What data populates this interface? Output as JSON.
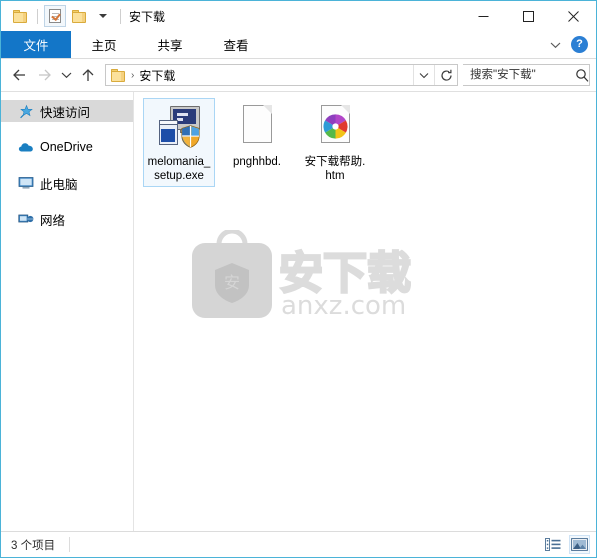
{
  "window": {
    "title": "安下载",
    "quick_access": {
      "folder_icon": "folder-icon",
      "properties_icon": "document-check-icon",
      "new_folder_icon": "folder-icon",
      "customize_icon": "chevron-down-icon"
    },
    "controls": {
      "minimize": "minimize-icon",
      "maximize": "maximize-icon",
      "close": "close-icon"
    }
  },
  "ribbon": {
    "tabs": [
      {
        "label": "文件",
        "active": true
      },
      {
        "label": "主页",
        "active": false
      },
      {
        "label": "共享",
        "active": false
      },
      {
        "label": "查看",
        "active": false
      }
    ],
    "collapse_icon": "chevron-down-icon",
    "help_label": "?"
  },
  "addressbar": {
    "back_icon": "arrow-left-icon",
    "forward_icon": "arrow-right-icon",
    "recent_icon": "chevron-down-icon",
    "up_icon": "arrow-up-icon",
    "folder_icon": "folder-icon",
    "breadcrumb": "安下载",
    "breadcrumb_separator": "›",
    "dropdown_icon": "chevron-down-icon",
    "refresh_icon": "refresh-icon"
  },
  "search": {
    "placeholder": "搜索\"安下载\"",
    "value": "",
    "icon": "search-icon"
  },
  "sidebar": {
    "items": [
      {
        "label": "快速访问",
        "icon": "star-pin-icon",
        "selected": true
      },
      {
        "label": "OneDrive",
        "icon": "cloud-icon",
        "selected": false
      },
      {
        "label": "此电脑",
        "icon": "computer-icon",
        "selected": false
      },
      {
        "label": "网络",
        "icon": "network-icon",
        "selected": false
      }
    ]
  },
  "files": {
    "items": [
      {
        "name": "melomania_setup.exe",
        "icon": "setup-exe-icon",
        "selected": true
      },
      {
        "name": "pnghhbd.",
        "icon": "blank-document-icon",
        "selected": false
      },
      {
        "name": "安下载帮助.htm",
        "icon": "html-document-icon",
        "selected": false
      }
    ]
  },
  "watermark": {
    "logo_text": "安",
    "brand": "安下载",
    "url": "anxz.com",
    "color": "#d8d8d8"
  },
  "statusbar": {
    "count_text": "3 个项目",
    "details_view_icon": "details-view-icon",
    "large_icons_view_icon": "large-icons-view-icon",
    "active_view": "large-icons-view-icon"
  },
  "colors": {
    "window_border": "#4bb3d8",
    "file_tab": "#1376c8",
    "selection": "#d9d9d9",
    "item_selection_border": "#aad6f5",
    "item_selection_fill": "#f2f8fd"
  }
}
